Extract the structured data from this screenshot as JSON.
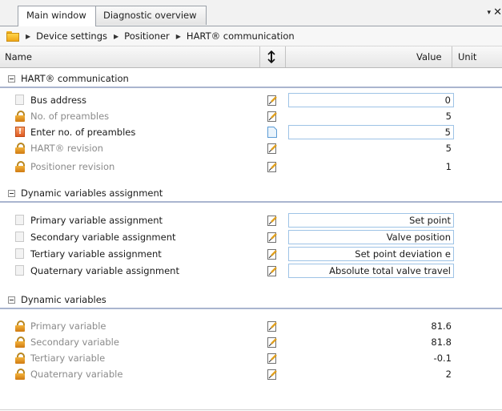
{
  "tabs": [
    {
      "label": "Main window",
      "active": true
    },
    {
      "label": "Diagnostic overview",
      "active": false
    }
  ],
  "tab_menu_glyph": "▾",
  "tab_close_glyph": "✕",
  "breadcrumb": {
    "icon": "folder-icon",
    "items": [
      "Device settings",
      "Positioner",
      "HART® communication"
    ]
  },
  "columns": {
    "name": "Name",
    "value": "Value",
    "unit": "Unit"
  },
  "sections": [
    {
      "title": "HART® communication",
      "rows": [
        {
          "label": "Bus address",
          "value": "0",
          "icon": "document-icon",
          "editable": true
        },
        {
          "label": "No. of preambles",
          "value": "5",
          "icon": "lock-icon",
          "editable": false
        },
        {
          "label": "Enter no. of preambles",
          "value": "5",
          "icon": "warning-icon",
          "editable": true
        },
        {
          "label": "HART® revision",
          "value": "5",
          "icon": "lock-icon",
          "editable": false
        },
        {
          "label": "Positioner revision",
          "value": "1",
          "icon": "lock-icon",
          "editable": false
        }
      ]
    },
    {
      "title": "Dynamic variables assignment",
      "rows": [
        {
          "label": "Primary variable assignment",
          "value": "Set point",
          "icon": "document-icon",
          "editable": true
        },
        {
          "label": "Secondary variable assignment",
          "value": "Valve position",
          "icon": "document-icon",
          "editable": true
        },
        {
          "label": "Tertiary variable assignment",
          "value": "Set point deviation e",
          "icon": "document-icon",
          "editable": true
        },
        {
          "label": "Quaternary variable assignment",
          "value": "Absolute total valve travel",
          "icon": "document-icon",
          "editable": true
        }
      ]
    },
    {
      "title": "Dynamic variables",
      "rows": [
        {
          "label": "Primary variable",
          "value": "81.6",
          "icon": "lock-icon",
          "editable": false
        },
        {
          "label": "Secondary variable",
          "value": "81.8",
          "icon": "lock-icon",
          "editable": false
        },
        {
          "label": "Tertiary variable",
          "value": "-0.1",
          "icon": "lock-icon",
          "editable": false
        },
        {
          "label": "Quaternary variable",
          "value": "2",
          "icon": "lock-icon",
          "editable": false
        }
      ]
    }
  ],
  "colors": {
    "section_rule": "#aab5cf",
    "input_border": "#9ec3e6",
    "lock": "#e39a2a",
    "warning": "#e05a22"
  }
}
